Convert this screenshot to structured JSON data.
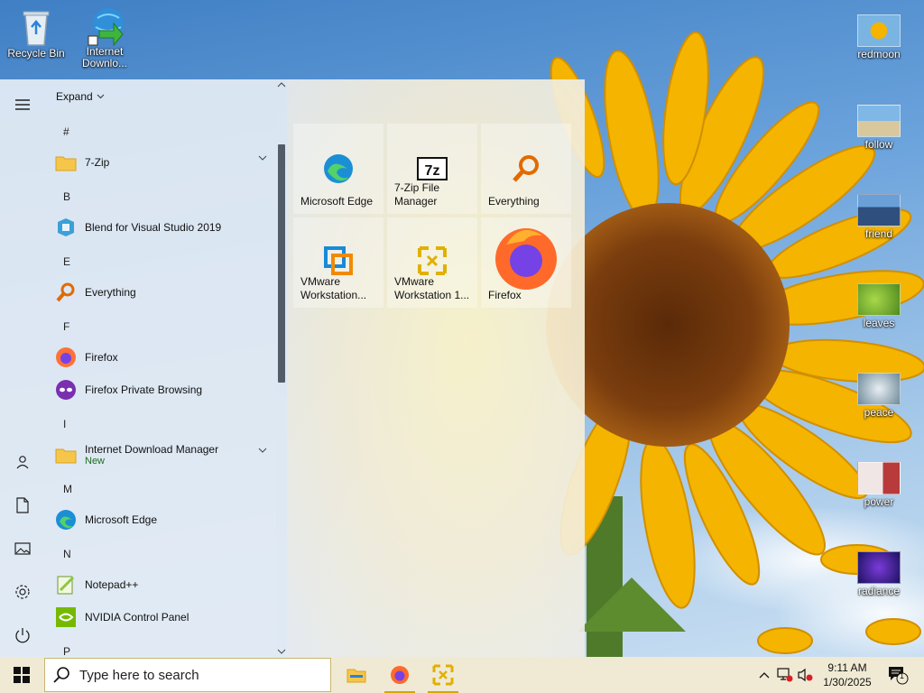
{
  "desktop": {
    "left_icons": [
      {
        "label": "Recycle Bin"
      },
      {
        "label": "Internet Downlo..."
      }
    ],
    "right_icons": [
      {
        "label": "redmoon"
      },
      {
        "label": "follow"
      },
      {
        "label": "friend"
      },
      {
        "label": "leaves"
      },
      {
        "label": "peace"
      },
      {
        "label": "power"
      },
      {
        "label": "radiance"
      }
    ]
  },
  "start_menu": {
    "expand_label": "Expand",
    "groups": [
      {
        "letter": "#"
      },
      {
        "letter": "B"
      },
      {
        "letter": "E"
      },
      {
        "letter": "F"
      },
      {
        "letter": "I"
      },
      {
        "letter": "M"
      },
      {
        "letter": "N"
      },
      {
        "letter": "P"
      }
    ],
    "apps": [
      {
        "label": "7-Zip",
        "icon": "folder-icon"
      },
      {
        "label": "Blend for Visual Studio 2019",
        "icon": "blend-icon"
      },
      {
        "label": "Everything",
        "icon": "everything-search-icon"
      },
      {
        "label": "Firefox",
        "icon": "firefox-icon"
      },
      {
        "label": "Firefox Private Browsing",
        "icon": "firefox-private-icon"
      },
      {
        "label": "Internet Download Manager",
        "sublabel": "New",
        "icon": "folder-icon"
      },
      {
        "label": "Microsoft Edge",
        "icon": "edge-icon"
      },
      {
        "label": "Notepad++",
        "icon": "notepad-plus-plus-icon"
      },
      {
        "label": "NVIDIA Control Panel",
        "icon": "nvidia-icon"
      }
    ],
    "tiles": [
      {
        "label": "Microsoft Edge"
      },
      {
        "label": "7-Zip File Manager"
      },
      {
        "label": "Everything"
      },
      {
        "label": "VMware Workstation..."
      },
      {
        "label": "VMware Workstation 1..."
      },
      {
        "label": "Firefox"
      }
    ]
  },
  "taskbar": {
    "search_placeholder": "Type here to search",
    "time": "9:11 AM",
    "date": "1/30/2025",
    "notification_count": "1"
  },
  "colors": {
    "taskbar_bg": "#f0ead4",
    "accent": "#d4a600",
    "panel_bg": "#e4ecf4"
  }
}
